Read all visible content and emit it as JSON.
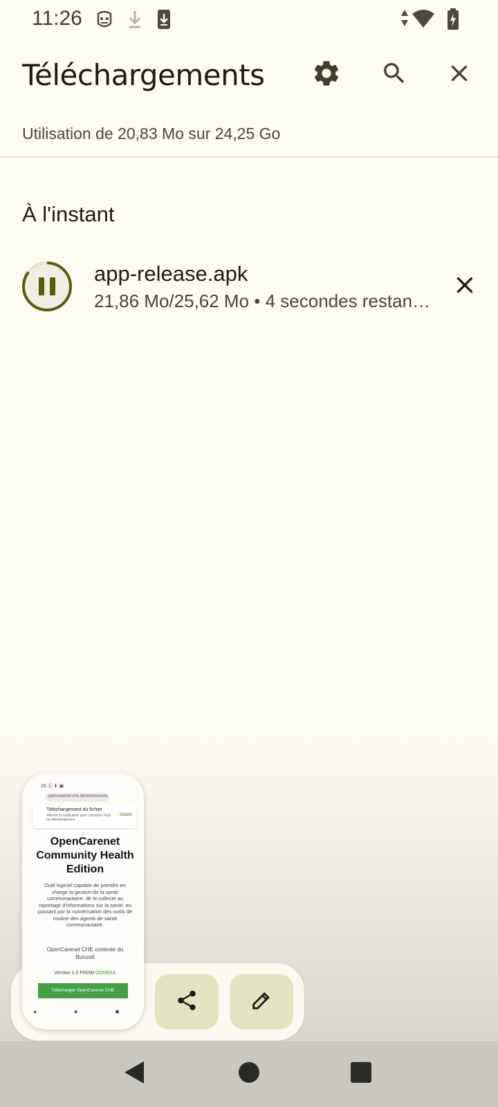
{
  "status_bar": {
    "time": "11:26",
    "icons": [
      "robot-icon",
      "download-arrow-icon",
      "download-box-icon",
      "data-arrows-icon",
      "wifi-icon",
      "battery-charging-icon"
    ]
  },
  "app_bar": {
    "title": "Téléchargements",
    "actions": [
      "gear-icon",
      "search-icon",
      "close-icon"
    ]
  },
  "storage": {
    "label": "Utilisation de 20,83 Mo sur 24,25 Go"
  },
  "section": {
    "title": "À l'instant"
  },
  "download": {
    "file_name": "app-release.apk",
    "progress_text": "21,86 Mo/25,62 Mo • 4 secondes restantes",
    "progress_fraction": 0.853,
    "accent_color": "#5b5a0f"
  },
  "screenshot_thumbnail": {
    "status": "26 ⓖ ⬇ ▣",
    "url": "opencarenet-che.dimensionsedu.org",
    "notif_title": "Téléchargement du fichier",
    "notif_sub": "Afficher la notification pour connaître l'état du téléchargement",
    "notif_action": "Détails",
    "page_title": "OpenCarenet Community Health Edition",
    "description": "Outil logiciel capable de prendre en charge la gestion de la santé communautaire, de la collecte au reportage d'informations sur la santé, en passant par la numérisation des outils de routine des agents de santé communautaire.",
    "context": "OpenCarenet CHE contexte du Burundi",
    "version_prefix": "Version 1.0 FROM",
    "version_brand": "DONEKA",
    "cta": "Télécharger OpenCarenet CHE",
    "nav": "◂ ● ■"
  },
  "panel_actions": [
    "share-icon",
    "edit-pencil-icon"
  ],
  "nav_bar": [
    "back-icon",
    "home-icon",
    "recents-icon"
  ],
  "colors": {
    "background": "#fefbf2",
    "panel_button": "#e4e3c1",
    "nav_bar": "#c9c7bf"
  }
}
